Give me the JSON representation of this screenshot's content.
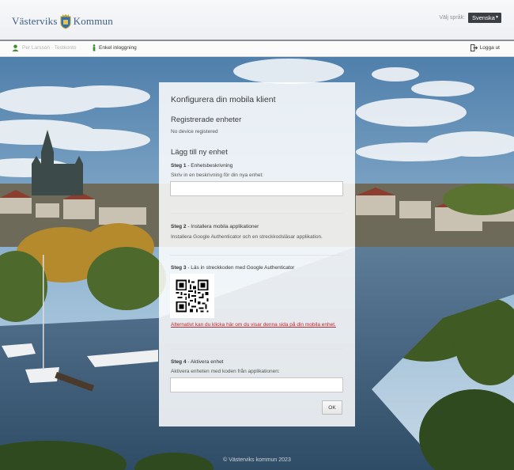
{
  "header": {
    "logo_left": "Västerviks",
    "logo_right": "Kommun",
    "language_label": "Välj språk:",
    "language_value": "Svenska"
  },
  "toolbar": {
    "user_name": "Per Larsson · Testkonto",
    "sso_label": "Enkel inloggning",
    "logout_label": "Logga ut"
  },
  "panel": {
    "title": "Konfigurera din mobila klient",
    "registered_heading": "Registrerade enheter",
    "registered_status": "No device registered",
    "add_heading": "Lägg till ny enhet",
    "step1": {
      "num": "Steg 1",
      "title": " - Enhetsbeskrivning",
      "hint": "Skriv in en beskrivning för din nya enhet:",
      "input_value": ""
    },
    "step2": {
      "num": "Steg 2",
      "title": " - Installera mobila applikationer",
      "hint": "Installera Google Authenticator och en streckkodsläsar applikation."
    },
    "step3": {
      "num": "Steg 3",
      "title": " - Läs in streckkoden med Google Authenticator",
      "link": "Alternativt kan du klicka här om du visar denna sida på din mobila enhet."
    },
    "step4": {
      "num": "Steg 4",
      "title": " - Aktivera enhet",
      "hint": "Aktivera enheten med koden från applikationen:",
      "input_value": ""
    },
    "ok_label": "OK"
  },
  "footer": {
    "text": "© Västerviks kommun 2023"
  },
  "colors": {
    "link": "#c0282d",
    "brand": "#3d5f86",
    "accent_green": "#3f8f2f"
  }
}
